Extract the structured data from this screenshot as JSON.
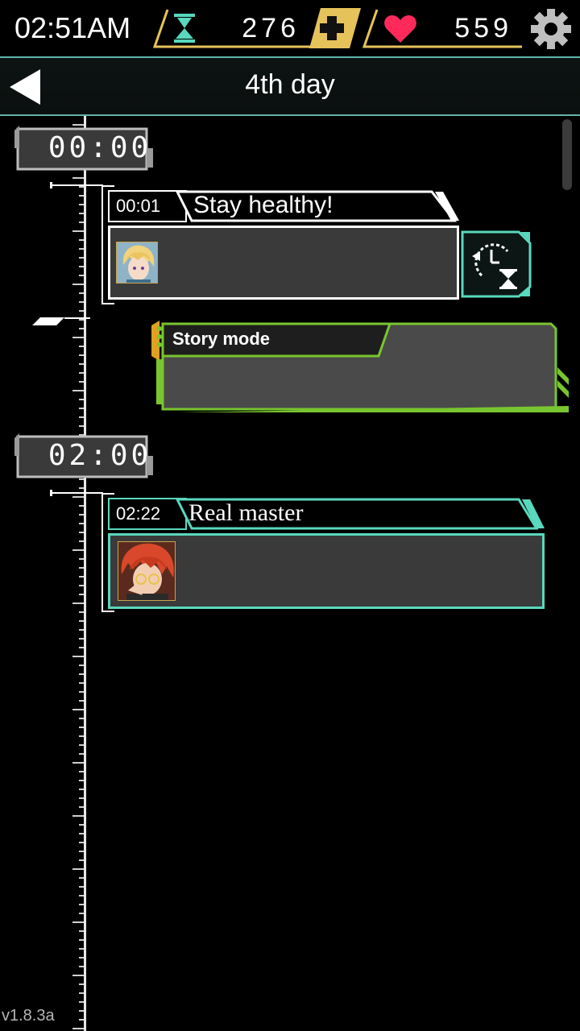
{
  "status_bar": {
    "clock": "02:51AM",
    "hourglass_count": "276",
    "heart_count": "559",
    "colors": {
      "frame": "#e6c25a",
      "hourglass": "#58d8bd",
      "heart": "#ff2a5a"
    },
    "icons": [
      "hourglass-icon",
      "plus-icon",
      "heart-icon",
      "gear-icon"
    ]
  },
  "header": {
    "title": "4th day",
    "back_icon": "back-arrow-icon"
  },
  "timeline": {
    "slots": [
      {
        "time": "00:00"
      },
      {
        "time": "02:00"
      }
    ],
    "chats": [
      {
        "time": "00:01",
        "title": "Stay healthy!",
        "accent": "#ffffff",
        "avatar": "blond-character-avatar",
        "side_icon": "clock-hourglass-icon",
        "side_accent": "#58d8bd"
      },
      {
        "time": "02:22",
        "title": "Real master",
        "accent": "#58d8bd",
        "avatar": "red-haired-character-avatar"
      }
    ],
    "story": {
      "label": "Story mode",
      "accent": "#79c52f",
      "notch_accent": "#e0a020"
    }
  },
  "version": "v1.8.3a"
}
